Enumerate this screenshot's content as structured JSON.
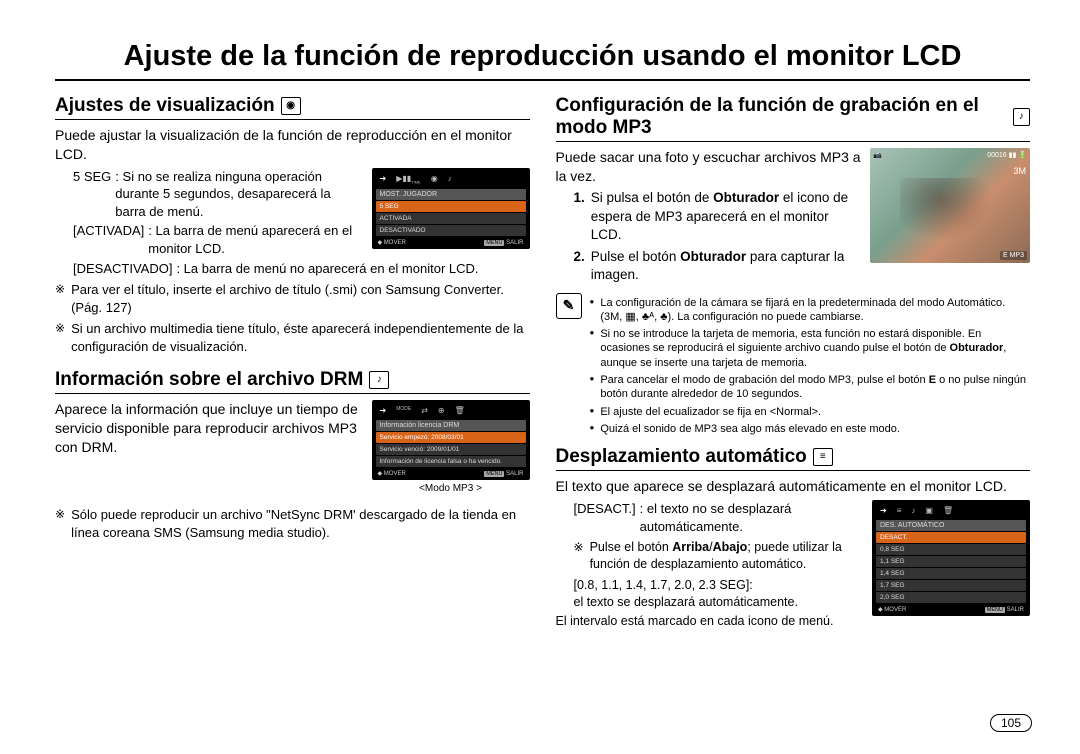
{
  "page_title": "Ajuste de la función de reproducción usando el monitor LCD",
  "page_number": "105",
  "left": {
    "sec1_title": "Ajustes de visualización",
    "sec1_intro": "Puede ajustar la visualización de la función de reproducción en el monitor LCD.",
    "def1_label": "5 SEG",
    "def1_text": ": Si no se realiza ninguna operación durante 5 segundos, desaparecerá la barra de menú.",
    "def2_label": "[ACTIVADA]",
    "def2_text": ": La barra de menú aparecerá en el monitor LCD.",
    "def3_label": "[DESACTIVADO]",
    "def3_text": ": La barra de menú no aparecerá en el monitor LCD.",
    "star1": "Para ver el título, inserte el archivo de título (.smi) con Samsung Converter. (Pág. 127)",
    "star2": "Si un archivo multimedia tiene título, éste aparecerá independientemente de la configuración de visualización.",
    "lcd1": {
      "title": "MOST. JUGADOR",
      "rows": [
        "5 SEG",
        "ACTIVADA",
        "DESACTIVADO"
      ],
      "foot_left": "◆ MOVER",
      "foot_menu": "MENU",
      "foot_right": "SALIR"
    },
    "sec2_title": "Información sobre el archivo DRM",
    "sec2_intro": "Aparece la información que incluye un tiempo de servicio disponible para reproducir archivos MP3 con DRM.",
    "lcd2": {
      "title": "Información licencia DRM",
      "rows": [
        "Servicio empezó: 2008/03/01",
        "Servicio venció: 2009/01/01",
        "Información de licencia falsa o ha vencido."
      ],
      "foot_left": "◆ MOVER",
      "foot_menu": "MENU",
      "foot_right": "SALIR",
      "caption": "<Modo MP3 >"
    },
    "star3": "Sólo puede reproducir un archivo \"NetSync DRM' descargado de la tienda en línea coreana SMS (Samsung media studio)."
  },
  "right": {
    "sec1_title": "Configuración de la función de grabación en el modo MP3",
    "sec1_intro": "Puede sacar una foto y escuchar archivos MP3 a la vez.",
    "n1_html": "Si pulsa el botón de <b>Obturador</b> el icono de espera de MP3 aparecerá en el monitor LCD.",
    "n2_html": "Pulse el botón <b>Obturador</b> para capturar la imagen.",
    "photo": {
      "top_left": "📷",
      "top_right": "00016  ▮▮ 🔋",
      "size": "3M",
      "bot_right": "E MP3"
    },
    "notes": [
      "La configuración de la cámara se fijará en la predeterminada del modo Automático. (3M, ▦, ♣ᴬ, ♣). La configuración no puede cambiarse.",
      "Si no se introduce la tarjeta de memoria, esta función no estará disponible. En ocasiones se reproducirá el siguiente archivo cuando pulse el botón de Obturador, aunque se inserte una tarjeta de memoria.",
      "Para cancelar el modo de grabación del modo MP3, pulse el botón E o no pulse ningún botón durante alrededor de 10 segundos.",
      "El ajuste del ecualizador se fija en <Normal>.",
      "Quizá el sonido de MP3 sea algo más elevado en este modo."
    ],
    "sec2_title": "Desplazamiento automático",
    "sec2_intro": "El texto que aparece se desplazará automáticamente en el monitor LCD.",
    "def1_label": "[DESACT.]",
    "def1_text": ": el texto no se desplazará automáticamente.",
    "star1_html": "Pulse el botón <b>Arriba</b>/<b>Abajo</b>; puede utilizar la función de desplazamiento automático.",
    "def2_label": "[0.8, 1.1, 1.4, 1.7, 2.0, 2.3 SEG]:",
    "def2_text": "el texto se desplazará automáticamente.",
    "outro": "El intervalo está marcado en cada icono de menú.",
    "lcd3": {
      "title": "DES. AUTOMÁTICO",
      "rows": [
        "DESACT.",
        "0,8 SEG",
        "1,1 SEG",
        "1,4 SEG",
        "1,7 SEG",
        "2,0 SEG"
      ],
      "foot_left": "◆ MOVER",
      "foot_menu": "MENU",
      "foot_right": "SALIR"
    }
  }
}
